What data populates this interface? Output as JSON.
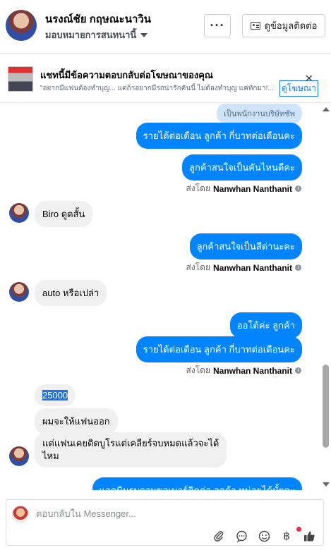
{
  "header": {
    "contact_name": "นรงณ์ชัย กฤษณะนาวิน",
    "assign_label": "มอบหมายการสนทนานี้",
    "more_label": "···",
    "contact_info_label": "ดูข้อมูลติดต่อ"
  },
  "ad": {
    "title": "แชทนี้มีข้อความตอบกลับต่อโฆษณาของคุณ",
    "subtitle": "\"อยากมีแฟนต้องทำบุญ... แต่ถ้าอยากมีรถน่ารักคันนี้ ไม่ต้องทำบุญ แค่ทักมา!...",
    "link_label": "ดูโฆษณา",
    "close_label": "✕"
  },
  "messages": {
    "m0": "เป็นพนักงานบริษัทชัพ",
    "m1": "รายได้ต่อเดือน ลูกค้า กี่บาทต่อเดือนคะ",
    "m2": "ลูกค้าสนใจเป็นคันไหนดีคะ",
    "m3": "Biro ดูดสั้น",
    "m4": "ลูกค้าสนใจเป็นสีด่านะคะ",
    "m5_a": "auto",
    "m5_b": " หรือเปล่า",
    "m6": "ออโต้ค่ะ  ลูกค้า",
    "m7": "รายได้ต่อเดือน ลูกค้า กี่บาทต่อเดือนคะ",
    "m8": "25000",
    "m9": "ผมจะให้แฟนออก",
    "m10_l1": "แต่แฟนเคยติดบูโรแต่เคลียร์จบหมดแล้วจะได้",
    "m10_l2": "ไหม",
    "m11": "แอดมินรบกวนขอเบอร์ติดต่อ ลูกค้า หน่อยได้มั้ยคะ"
  },
  "sent_by": {
    "prefix": "ส่งโดย",
    "name": "Nanwhan Nanthanit"
  },
  "composer": {
    "placeholder": "ตอบกลับใน Messenger..."
  },
  "icons": {
    "attach": "paperclip-icon",
    "sticker": "chat-bubble-icon",
    "emoji": "smiley-icon",
    "payment": "baht-icon",
    "like": "thumbs-up-icon"
  }
}
